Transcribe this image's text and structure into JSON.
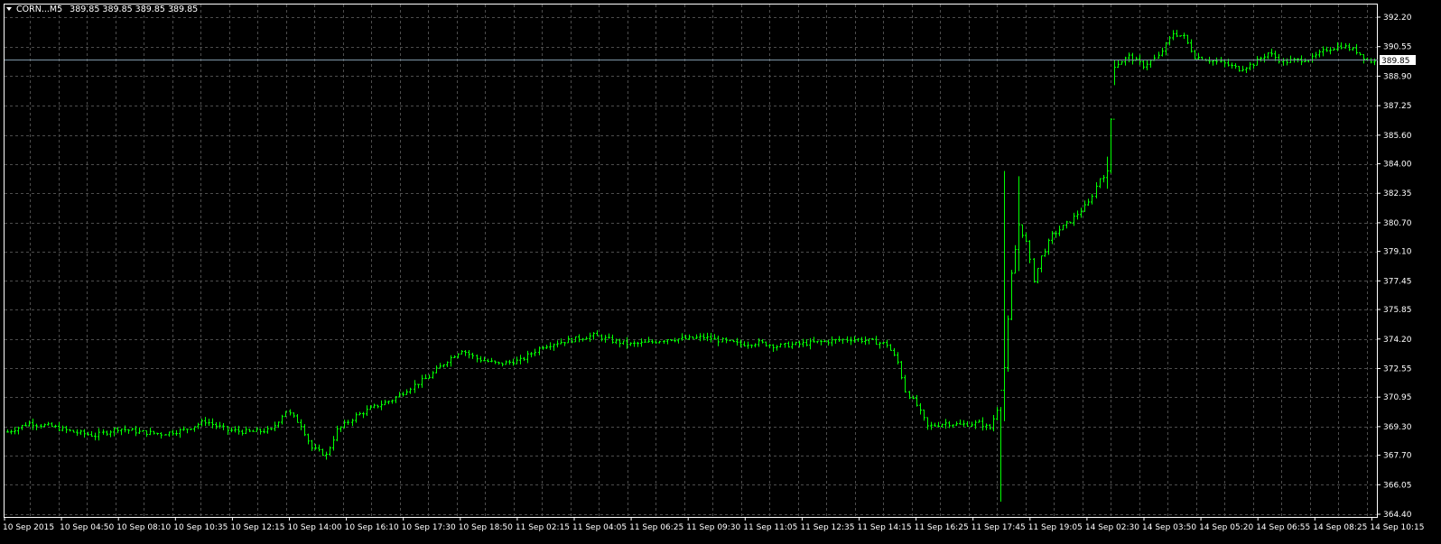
{
  "window": {
    "header": {
      "symbol": "CORN...M5",
      "ohlc": "389.85 389.85 389.85 389.85",
      "dropdown_icon": "triangle-down-icon"
    }
  },
  "chart_data": {
    "type": "candlestick",
    "timeframe": "M5",
    "colors": {
      "background": "#000000",
      "grid": "#4d4d4d",
      "bars": "#00ff00",
      "axis_text": "#ffffff",
      "current_price_line": "#7f97a8",
      "current_price_label_bg": "#ffffff",
      "current_price_label_fg": "#000000"
    },
    "grid": true,
    "y_axis": {
      "min": 364.4,
      "max": 392.2,
      "ticks": [
        "392.20",
        "390.55",
        "388.90",
        "387.25",
        "385.60",
        "384.00",
        "382.35",
        "380.70",
        "379.10",
        "377.45",
        "375.85",
        "374.20",
        "372.55",
        "370.95",
        "369.30",
        "367.70",
        "366.05",
        "364.40"
      ]
    },
    "x_axis": {
      "ticks": [
        "10 Sep 2015",
        "10 Sep 04:50",
        "10 Sep 08:10",
        "10 Sep 10:35",
        "10 Sep 12:15",
        "10 Sep 14:00",
        "10 Sep 16:10",
        "10 Sep 17:30",
        "10 Sep 18:50",
        "11 Sep 02:15",
        "11 Sep 04:05",
        "11 Sep 06:25",
        "11 Sep 09:30",
        "11 Sep 11:05",
        "11 Sep 12:35",
        "11 Sep 14:15",
        "11 Sep 16:25",
        "11 Sep 17:45",
        "11 Sep 19:05",
        "14 Sep 02:30",
        "14 Sep 03:50",
        "14 Sep 05:20",
        "14 Sep 06:55",
        "14 Sep 08:25",
        "14 Sep 10:15"
      ]
    },
    "current_price": 389.85,
    "price_path": [
      [
        0,
        369.0
      ],
      [
        6,
        369.5
      ],
      [
        12,
        369.3
      ],
      [
        18,
        369.0
      ],
      [
        24,
        368.8
      ],
      [
        30,
        369.2
      ],
      [
        36,
        369.0
      ],
      [
        42,
        368.9
      ],
      [
        48,
        369.1
      ],
      [
        54,
        369.6
      ],
      [
        60,
        369.1
      ],
      [
        66,
        369.0
      ],
      [
        72,
        369.1
      ],
      [
        76,
        370.2
      ],
      [
        80,
        369.4
      ],
      [
        83,
        368.1
      ],
      [
        87,
        367.7
      ],
      [
        90,
        369.1
      ],
      [
        95,
        369.9
      ],
      [
        100,
        370.4
      ],
      [
        105,
        370.8
      ],
      [
        110,
        371.5
      ],
      [
        115,
        372.1
      ],
      [
        120,
        373.0
      ],
      [
        124,
        373.6
      ],
      [
        128,
        373.1
      ],
      [
        134,
        372.8
      ],
      [
        140,
        373.0
      ],
      [
        146,
        373.8
      ],
      [
        150,
        374.0
      ],
      [
        155,
        374.2
      ],
      [
        160,
        374.4
      ],
      [
        165,
        374.1
      ],
      [
        170,
        373.9
      ],
      [
        175,
        374.0
      ],
      [
        180,
        374.2
      ],
      [
        185,
        374.2
      ],
      [
        190,
        374.3
      ],
      [
        195,
        374.1
      ],
      [
        200,
        373.9
      ],
      [
        205,
        374.0
      ],
      [
        210,
        373.8
      ],
      [
        215,
        373.9
      ],
      [
        220,
        374.0
      ],
      [
        225,
        374.1
      ],
      [
        230,
        374.2
      ],
      [
        235,
        374.1
      ],
      [
        240,
        373.9
      ],
      [
        243,
        372.9
      ],
      [
        245,
        371.3
      ],
      [
        248,
        370.5
      ],
      [
        251,
        369.3
      ],
      [
        256,
        369.5
      ],
      [
        260,
        369.4
      ],
      [
        265,
        369.5
      ],
      [
        268,
        369.2
      ],
      [
        270,
        370.3
      ],
      [
        272,
        372.6
      ],
      [
        274,
        377.8
      ],
      [
        276,
        380.6
      ],
      [
        278,
        379.6
      ],
      [
        280,
        377.5
      ],
      [
        282,
        378.8
      ],
      [
        285,
        380.0
      ],
      [
        290,
        380.8
      ],
      [
        295,
        381.8
      ],
      [
        298,
        383.2
      ],
      [
        300,
        383.5
      ],
      [
        302,
        389.5
      ],
      [
        306,
        390.0
      ],
      [
        310,
        389.5
      ],
      [
        314,
        390.0
      ],
      [
        318,
        391.3
      ],
      [
        321,
        391.1
      ],
      [
        324,
        390.0
      ],
      [
        328,
        389.8
      ],
      [
        332,
        389.6
      ],
      [
        336,
        389.3
      ],
      [
        340,
        389.6
      ],
      [
        344,
        390.2
      ],
      [
        348,
        389.7
      ],
      [
        352,
        389.8
      ],
      [
        356,
        389.9
      ],
      [
        360,
        390.4
      ],
      [
        364,
        390.6
      ],
      [
        368,
        390.3
      ],
      [
        371,
        389.8
      ],
      [
        373,
        389.7
      ]
    ],
    "spikes": [
      {
        "index": 271,
        "high": 370.4,
        "low": 365.1
      },
      {
        "index": 272,
        "high": 383.6,
        "low": 369.6
      },
      {
        "index": 276,
        "high": 383.3,
        "low": 378.0
      },
      {
        "index": 300,
        "high": 384.4,
        "low": 382.6
      },
      {
        "index": 302,
        "high": 389.8,
        "low": 388.4
      }
    ],
    "bar_count": 374
  }
}
